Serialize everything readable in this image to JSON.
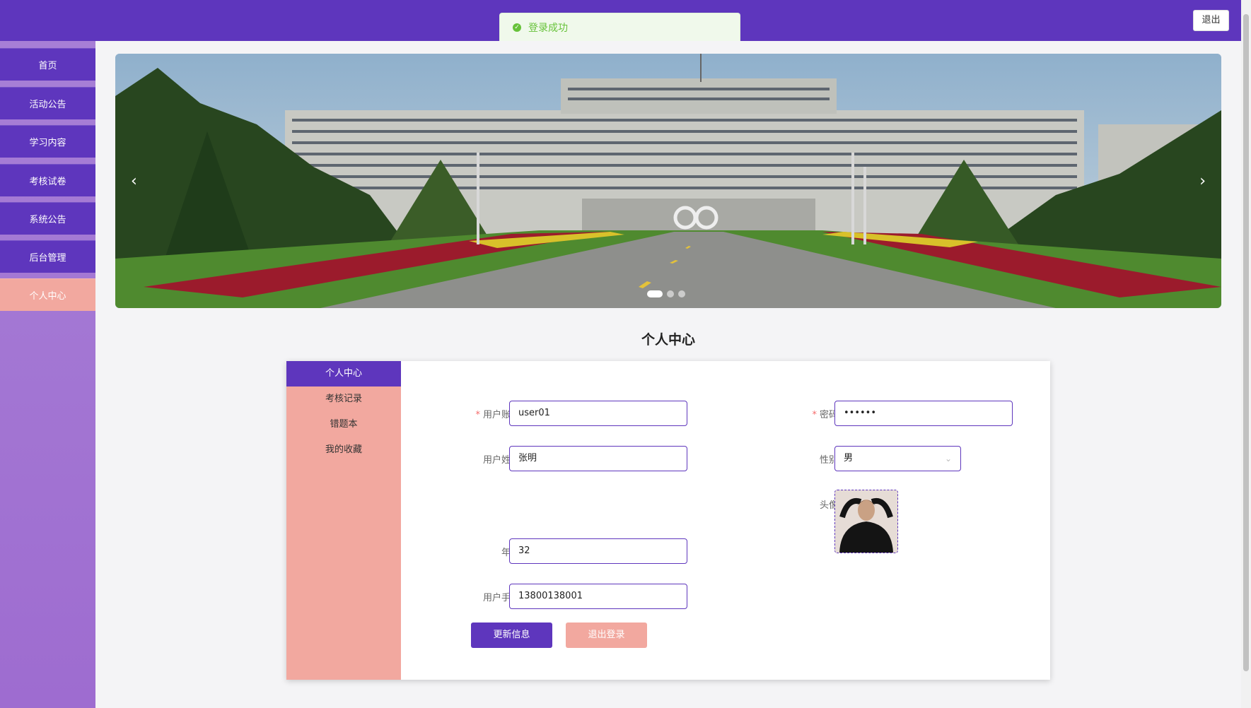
{
  "header": {
    "logout_label": "退出"
  },
  "toast": {
    "message": "登录成功",
    "icon": "success-check-icon",
    "color": "#67c23a"
  },
  "nav": {
    "items": [
      {
        "label": "首页"
      },
      {
        "label": "活动公告"
      },
      {
        "label": "学习内容"
      },
      {
        "label": "考核试卷"
      },
      {
        "label": "系统公告"
      },
      {
        "label": "后台管理"
      },
      {
        "label": "个人中心"
      }
    ],
    "active_index": 6
  },
  "banner": {
    "slide_count": 3,
    "active_slide": 1,
    "prev_icon": "chevron-left-icon",
    "next_icon": "chevron-right-icon"
  },
  "page": {
    "title": "个人中心"
  },
  "profile_menu": {
    "items": [
      {
        "label": "个人中心"
      },
      {
        "label": "考核记录"
      },
      {
        "label": "错题本"
      },
      {
        "label": "我的收藏"
      }
    ],
    "active_index": 0
  },
  "form": {
    "username": {
      "label": "用户账号",
      "value": "user01",
      "required": true
    },
    "password": {
      "label": "密码",
      "value": "••••••",
      "required": true
    },
    "realname": {
      "label": "用户姓名",
      "value": "张明"
    },
    "gender": {
      "label": "性别",
      "value": "男"
    },
    "avatar": {
      "label": "头像"
    },
    "age": {
      "label": "年龄",
      "value": "32"
    },
    "phone": {
      "label": "用户手机",
      "value": "13800138001"
    },
    "required_mark": "*"
  },
  "actions": {
    "update_label": "更新信息",
    "logout_label": "退出登录"
  },
  "colors": {
    "primary": "#5e36bd",
    "accent": "#f2a89f",
    "sidebar": "#a77fd6"
  }
}
